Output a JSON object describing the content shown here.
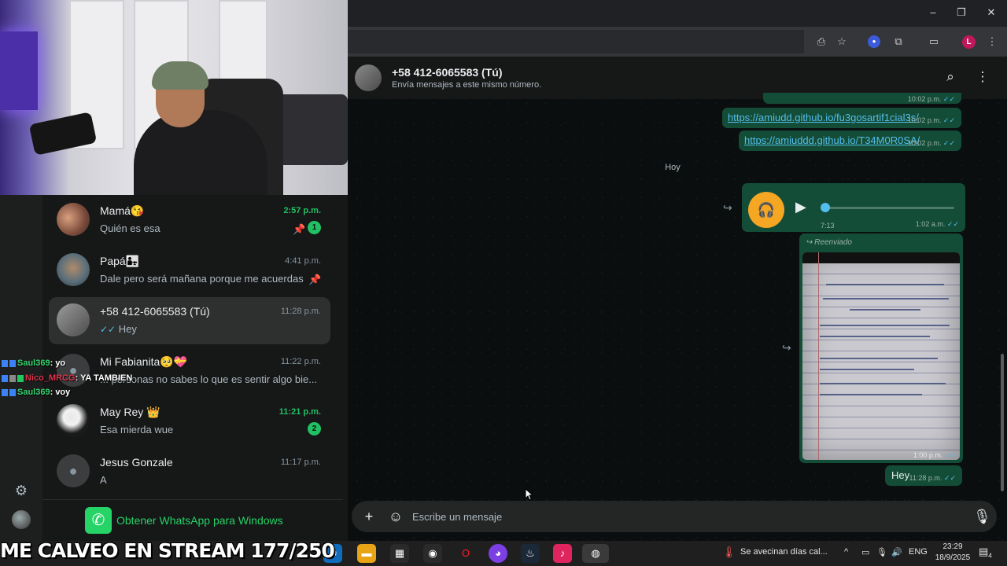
{
  "browser": {
    "window_controls": [
      "–",
      "❐",
      "✕"
    ],
    "profile_initial": "L",
    "toolbar_icons": [
      "install-icon",
      "star-icon",
      "extension-badge-icon",
      "puzzle-icon",
      "cast-icon",
      "menu-icon"
    ]
  },
  "conversation": {
    "title": "+58 412-6065583 (Tú)",
    "subtitle": "Envía mensajes a este mismo número.",
    "messages": [
      {
        "type": "partial",
        "time": "10:02 p.m."
      },
      {
        "type": "link",
        "text": "https://amiudd.github.io/fu3gosartif1cial3s/",
        "time": "10:02 p.m."
      },
      {
        "type": "link",
        "text": "https://amiuddd.github.io/T34M0R0SA/",
        "time": "10:02 p.m."
      },
      {
        "type": "day",
        "text": "Hoy"
      },
      {
        "type": "audio",
        "duration": "7:13",
        "time": "1:02 a.m.",
        "progress": 0.0
      },
      {
        "type": "image",
        "label": "Reenviado",
        "time": "1:00 p.m."
      },
      {
        "type": "text",
        "text": "Hey",
        "time": "11:28 p.m."
      }
    ],
    "composer_placeholder": "Escribe un mensaje"
  },
  "chat_list": [
    {
      "name": "Mamá😘",
      "preview": "Quién es esa",
      "time": "2:57 p.m.",
      "unread": 1,
      "pinned": true
    },
    {
      "name": "Papá👨‍👧",
      "preview": "Dale pero será mañana porque me acuerdas",
      "time": "4:41 p.m.",
      "pinned": true
    },
    {
      "name": "+58 412-6065583 (Tú)",
      "preview": "Hey",
      "time": "11:28 p.m.",
      "active": true
    },
    {
      "name": "Mi Fabianita🥺💝",
      "preview": "... personas no sabes lo que es sentir algo bie...",
      "time": "11:22 p.m."
    },
    {
      "name": "May Rey 👑",
      "preview": "Esa mierda wue",
      "time": "11:21 p.m.",
      "unread": 2
    },
    {
      "name": "Jesus Gonzale",
      "preview": "A",
      "time": "11:17 p.m."
    }
  ],
  "get_whatsapp": "Obtener WhatsApp para Windows",
  "stream_chat": [
    {
      "user": "Saul369",
      "msg": ": yo"
    },
    {
      "user": "Nico_MRCG",
      "msg": ": YA TAMBIEN"
    },
    {
      "user": "Saul369",
      "msg": ": voy"
    }
  ],
  "stream_banner": "ME CALVEO EN STREAM 177/250",
  "taskbar": {
    "weather": "Se avecinan días cal...",
    "language": "ENG",
    "time": "23:29",
    "date": "18/9/2025",
    "notifications": "4"
  }
}
